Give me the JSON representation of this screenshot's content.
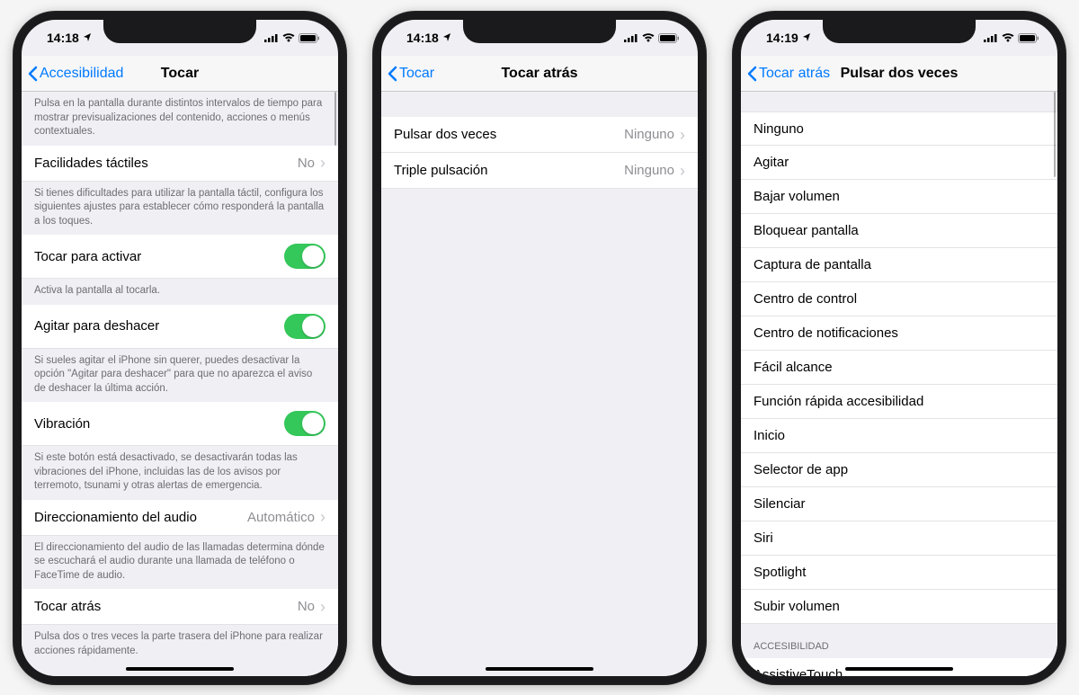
{
  "phone1": {
    "time": "14:18",
    "back": "Accesibilidad",
    "title": "Tocar",
    "intro": "Pulsa en la pantalla durante distintos intervalos de tiempo para mostrar previsualizaciones del contenido, acciones o menús contextuales.",
    "row_facilidades": "Facilidades táctiles",
    "val_facilidades": "No",
    "foot_facilidades": "Si tienes dificultades para utilizar la pantalla táctil, configura los siguientes ajustes para establecer cómo responderá la pantalla a los toques.",
    "row_tocar_activar": "Tocar para activar",
    "foot_tocar_activar": "Activa la pantalla al tocarla.",
    "row_agitar": "Agitar para deshacer",
    "foot_agitar": "Si sueles agitar el iPhone sin querer, puedes desactivar la opción \"Agitar para deshacer\" para que no aparezca el aviso de deshacer la última acción.",
    "row_vibracion": "Vibración",
    "foot_vibracion": "Si este botón está desactivado, se desactivarán todas las vibraciones del iPhone, incluidas las de los avisos por terremoto, tsunami y otras alertas de emergencia.",
    "row_audio": "Direccionamiento del audio",
    "val_audio": "Automático",
    "foot_audio": "El direccionamiento del audio de las llamadas determina dónde se escuchará el audio durante una llamada de teléfono o FaceTime de audio.",
    "row_tocar_atras": "Tocar atrás",
    "val_tocar_atras": "No",
    "foot_tocar_atras": "Pulsa dos o tres veces la parte trasera del iPhone para realizar acciones rápidamente."
  },
  "phone2": {
    "time": "14:18",
    "back": "Tocar",
    "title": "Tocar atrás",
    "row_double": "Pulsar dos veces",
    "val_double": "Ninguno",
    "row_triple": "Triple pulsación",
    "val_triple": "Ninguno"
  },
  "phone3": {
    "time": "14:19",
    "back": "Tocar atrás",
    "title": "Pulsar dos veces",
    "options": [
      "Ninguno",
      "Agitar",
      "Bajar volumen",
      "Bloquear pantalla",
      "Captura de pantalla",
      "Centro de control",
      "Centro de notificaciones",
      "Fácil alcance",
      "Función rápida accesibilidad",
      "Inicio",
      "Selector de app",
      "Silenciar",
      "Siri",
      "Spotlight",
      "Subir volumen"
    ],
    "section2_header": "ACCESIBILIDAD",
    "section2_item": "AssistiveTouch"
  }
}
